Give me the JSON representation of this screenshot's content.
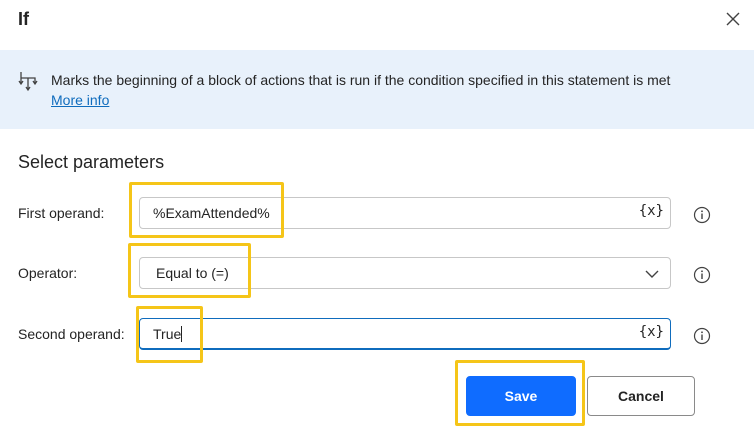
{
  "dialog": {
    "title": "If",
    "close_icon": "close-icon"
  },
  "banner": {
    "icon": "block-start-icon",
    "text": "Marks the beginning of a block of actions that is run if the condition specified in this statement is met",
    "link": "More info",
    "background": "#e8f1fb"
  },
  "params": {
    "heading": "Select parameters",
    "first_operand": {
      "label": "First operand:",
      "value": "%ExamAttended%",
      "var_button": "{x}"
    },
    "operator": {
      "label": "Operator:",
      "value": "Equal to (=)"
    },
    "second_operand": {
      "label": "Second operand:",
      "value": "True",
      "var_button": "{x}"
    }
  },
  "footer": {
    "save_label": "Save",
    "cancel_label": "Cancel"
  },
  "colors": {
    "accent": "#0f6cff",
    "highlight": "#f5c518",
    "link": "#0f6cbd"
  }
}
